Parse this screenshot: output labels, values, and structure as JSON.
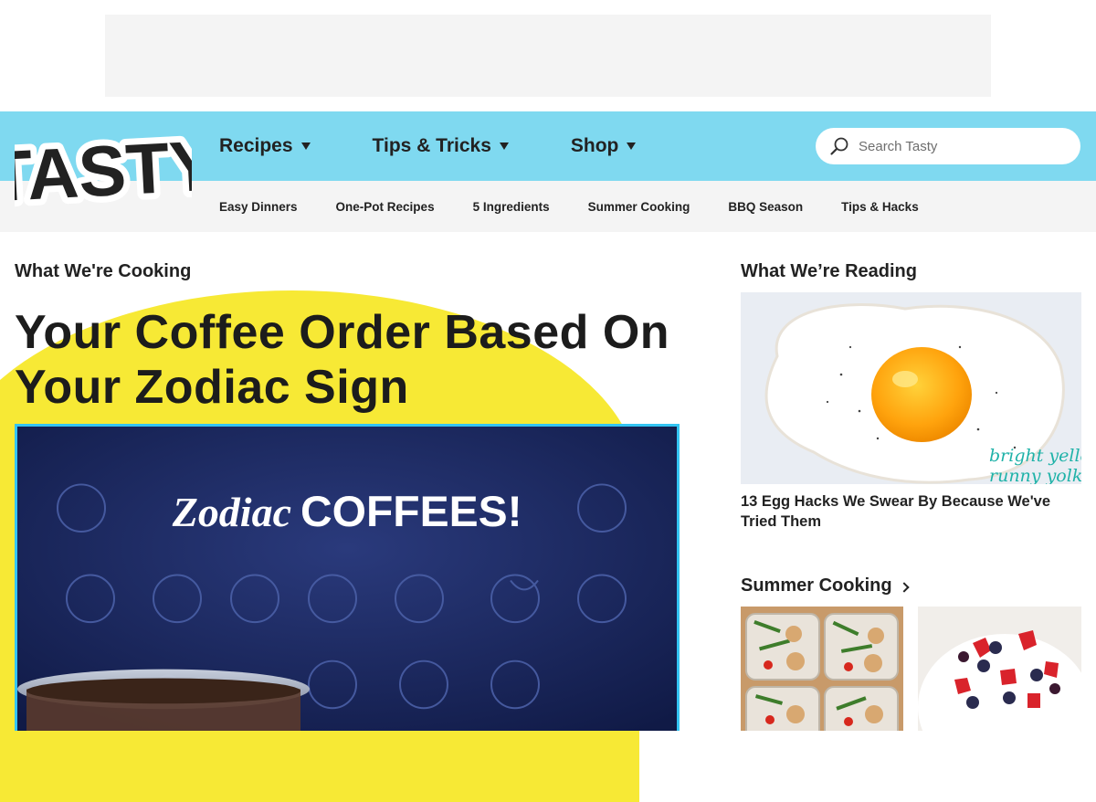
{
  "brand": {
    "logo_text": "TASTY",
    "header_color": "#7fd9f0",
    "accent_yellow": "#f7e935",
    "accent_blue": "#33c4f2"
  },
  "nav": {
    "main": [
      {
        "label": "Recipes"
      },
      {
        "label": "Tips & Tricks"
      },
      {
        "label": "Shop"
      }
    ],
    "sub": [
      {
        "label": "Easy Dinners"
      },
      {
        "label": "One-Pot Recipes"
      },
      {
        "label": "5 Ingredients"
      },
      {
        "label": "Summer Cooking"
      },
      {
        "label": "BBQ Season"
      },
      {
        "label": "Tips & Hacks"
      }
    ]
  },
  "search": {
    "placeholder": "Search Tasty",
    "icon": "search-icon"
  },
  "left": {
    "section_title": "What We're Cooking",
    "hero_title": "Your Coffee Order Based On Your Zodiac Sign",
    "hero_image_text": "Zodiac COFFEES!"
  },
  "right": {
    "section_title": "What We’re Reading",
    "article_caption": "13 Egg Hacks We Swear By Because We've Tried Them",
    "article_image_text": "bright yellow, runny yolk",
    "summer": {
      "title": "Summer Cooking",
      "icon": "chevron-right-icon"
    }
  }
}
